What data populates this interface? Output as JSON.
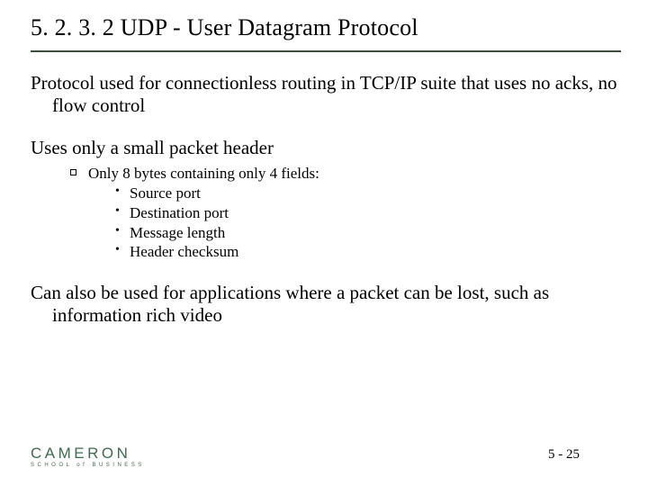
{
  "header": {
    "title": "5. 2. 3. 2  UDP - User Datagram Protocol"
  },
  "body": {
    "p1": "Protocol used for connectionless routing in TCP/IP suite that uses no acks, no flow control",
    "p2": "Uses only a small packet header",
    "sub1": "Only 8 bytes containing only 4 fields:",
    "fields": {
      "f1": "Source port",
      "f2": "Destination port",
      "f3": "Message length",
      "f4": "Header checksum"
    },
    "p3": "Can also be used for applications where a packet can be lost, such as information rich video"
  },
  "footer": {
    "brand_word": "CAMERON",
    "brand_tag": "SCHOOL of BUSINESS",
    "page": "5 - 25"
  }
}
